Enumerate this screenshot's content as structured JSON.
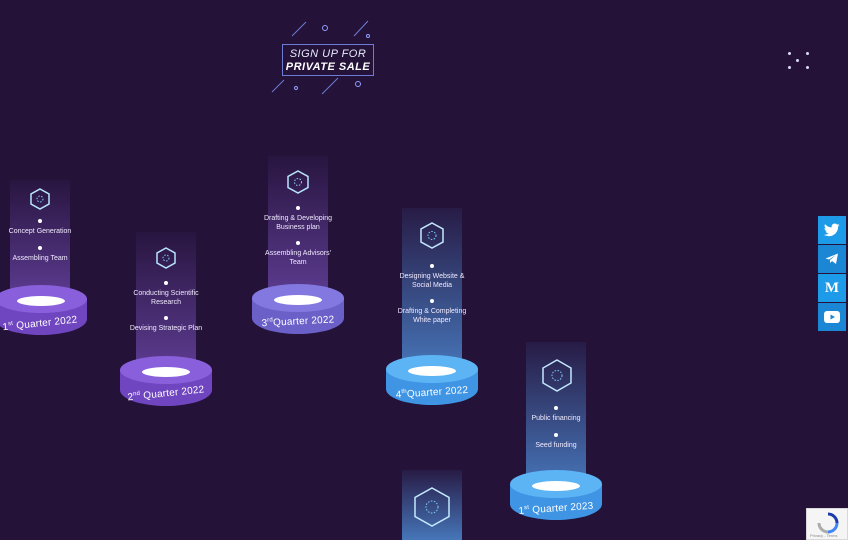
{
  "header": {
    "signup_line1": "SIGN UP FOR",
    "signup_line2": "PRIVATE SALE"
  },
  "colors": {
    "background": "#241238",
    "purple_ring": "#7a5bd0",
    "blue_ring": "#4aa6ef",
    "social": "#1e9be8"
  },
  "social": [
    {
      "icon": "twitter-icon"
    },
    {
      "icon": "telegram-icon"
    },
    {
      "icon": "medium-icon"
    },
    {
      "icon": "youtube-icon"
    }
  ],
  "roadmap": {
    "q1_2022": {
      "quarter": "1",
      "sup": "st",
      "rest": "Quarter 2022",
      "items": [
        "Concept Generation",
        "Assembling Team"
      ]
    },
    "q2_2022": {
      "quarter": "2",
      "sup": "nd",
      "rest": "Quarter 2022",
      "items": [
        "Conducting Scientific Research",
        "Devising Strategic Plan"
      ]
    },
    "q3_2022": {
      "quarter": "3",
      "sup": "rd",
      "rest": "Quarter 2022",
      "items": [
        "Drafting & Developing Business plan",
        "Assembling Advisors' Team"
      ]
    },
    "q4_2022": {
      "quarter": "4",
      "sup": "th",
      "rest": "Quarter 2022",
      "items": [
        "Designing Website & Social Media",
        "Drafting & Completing White paper"
      ]
    },
    "q1_2023": {
      "quarter": "1",
      "sup": "st",
      "rest": "Quarter 2023",
      "items": [
        "Public financing",
        "Seed funding"
      ]
    }
  },
  "recaptcha": {
    "text": "Privacy - Terms"
  }
}
